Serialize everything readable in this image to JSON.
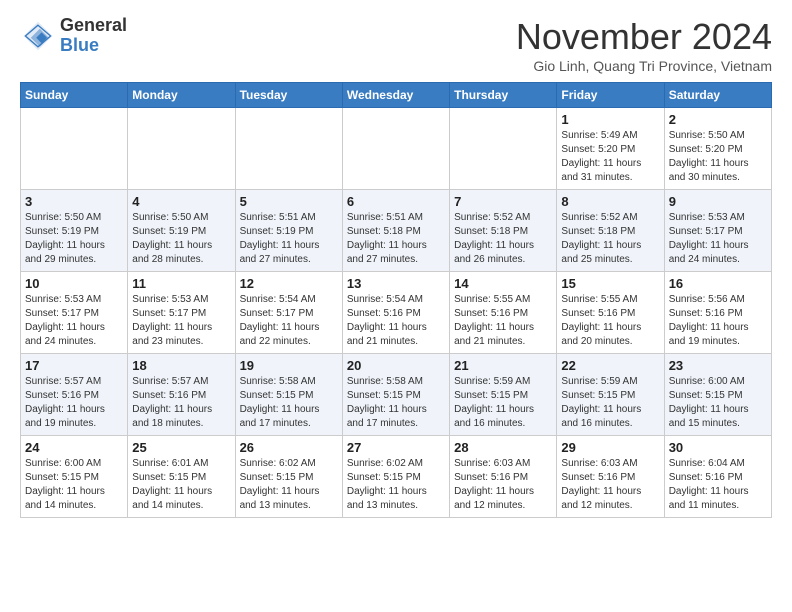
{
  "logo": {
    "general": "General",
    "blue": "Blue"
  },
  "header": {
    "month": "November 2024",
    "location": "Gio Linh, Quang Tri Province, Vietnam"
  },
  "weekdays": [
    "Sunday",
    "Monday",
    "Tuesday",
    "Wednesday",
    "Thursday",
    "Friday",
    "Saturday"
  ],
  "weeks": [
    [
      {
        "day": "",
        "info": ""
      },
      {
        "day": "",
        "info": ""
      },
      {
        "day": "",
        "info": ""
      },
      {
        "day": "",
        "info": ""
      },
      {
        "day": "",
        "info": ""
      },
      {
        "day": "1",
        "info": "Sunrise: 5:49 AM\nSunset: 5:20 PM\nDaylight: 11 hours and 31 minutes."
      },
      {
        "day": "2",
        "info": "Sunrise: 5:50 AM\nSunset: 5:20 PM\nDaylight: 11 hours and 30 minutes."
      }
    ],
    [
      {
        "day": "3",
        "info": "Sunrise: 5:50 AM\nSunset: 5:19 PM\nDaylight: 11 hours and 29 minutes."
      },
      {
        "day": "4",
        "info": "Sunrise: 5:50 AM\nSunset: 5:19 PM\nDaylight: 11 hours and 28 minutes."
      },
      {
        "day": "5",
        "info": "Sunrise: 5:51 AM\nSunset: 5:19 PM\nDaylight: 11 hours and 27 minutes."
      },
      {
        "day": "6",
        "info": "Sunrise: 5:51 AM\nSunset: 5:18 PM\nDaylight: 11 hours and 27 minutes."
      },
      {
        "day": "7",
        "info": "Sunrise: 5:52 AM\nSunset: 5:18 PM\nDaylight: 11 hours and 26 minutes."
      },
      {
        "day": "8",
        "info": "Sunrise: 5:52 AM\nSunset: 5:18 PM\nDaylight: 11 hours and 25 minutes."
      },
      {
        "day": "9",
        "info": "Sunrise: 5:53 AM\nSunset: 5:17 PM\nDaylight: 11 hours and 24 minutes."
      }
    ],
    [
      {
        "day": "10",
        "info": "Sunrise: 5:53 AM\nSunset: 5:17 PM\nDaylight: 11 hours and 24 minutes."
      },
      {
        "day": "11",
        "info": "Sunrise: 5:53 AM\nSunset: 5:17 PM\nDaylight: 11 hours and 23 minutes."
      },
      {
        "day": "12",
        "info": "Sunrise: 5:54 AM\nSunset: 5:17 PM\nDaylight: 11 hours and 22 minutes."
      },
      {
        "day": "13",
        "info": "Sunrise: 5:54 AM\nSunset: 5:16 PM\nDaylight: 11 hours and 21 minutes."
      },
      {
        "day": "14",
        "info": "Sunrise: 5:55 AM\nSunset: 5:16 PM\nDaylight: 11 hours and 21 minutes."
      },
      {
        "day": "15",
        "info": "Sunrise: 5:55 AM\nSunset: 5:16 PM\nDaylight: 11 hours and 20 minutes."
      },
      {
        "day": "16",
        "info": "Sunrise: 5:56 AM\nSunset: 5:16 PM\nDaylight: 11 hours and 19 minutes."
      }
    ],
    [
      {
        "day": "17",
        "info": "Sunrise: 5:57 AM\nSunset: 5:16 PM\nDaylight: 11 hours and 19 minutes."
      },
      {
        "day": "18",
        "info": "Sunrise: 5:57 AM\nSunset: 5:16 PM\nDaylight: 11 hours and 18 minutes."
      },
      {
        "day": "19",
        "info": "Sunrise: 5:58 AM\nSunset: 5:15 PM\nDaylight: 11 hours and 17 minutes."
      },
      {
        "day": "20",
        "info": "Sunrise: 5:58 AM\nSunset: 5:15 PM\nDaylight: 11 hours and 17 minutes."
      },
      {
        "day": "21",
        "info": "Sunrise: 5:59 AM\nSunset: 5:15 PM\nDaylight: 11 hours and 16 minutes."
      },
      {
        "day": "22",
        "info": "Sunrise: 5:59 AM\nSunset: 5:15 PM\nDaylight: 11 hours and 16 minutes."
      },
      {
        "day": "23",
        "info": "Sunrise: 6:00 AM\nSunset: 5:15 PM\nDaylight: 11 hours and 15 minutes."
      }
    ],
    [
      {
        "day": "24",
        "info": "Sunrise: 6:00 AM\nSunset: 5:15 PM\nDaylight: 11 hours and 14 minutes."
      },
      {
        "day": "25",
        "info": "Sunrise: 6:01 AM\nSunset: 5:15 PM\nDaylight: 11 hours and 14 minutes."
      },
      {
        "day": "26",
        "info": "Sunrise: 6:02 AM\nSunset: 5:15 PM\nDaylight: 11 hours and 13 minutes."
      },
      {
        "day": "27",
        "info": "Sunrise: 6:02 AM\nSunset: 5:15 PM\nDaylight: 11 hours and 13 minutes."
      },
      {
        "day": "28",
        "info": "Sunrise: 6:03 AM\nSunset: 5:16 PM\nDaylight: 11 hours and 12 minutes."
      },
      {
        "day": "29",
        "info": "Sunrise: 6:03 AM\nSunset: 5:16 PM\nDaylight: 11 hours and 12 minutes."
      },
      {
        "day": "30",
        "info": "Sunrise: 6:04 AM\nSunset: 5:16 PM\nDaylight: 11 hours and 11 minutes."
      }
    ]
  ]
}
